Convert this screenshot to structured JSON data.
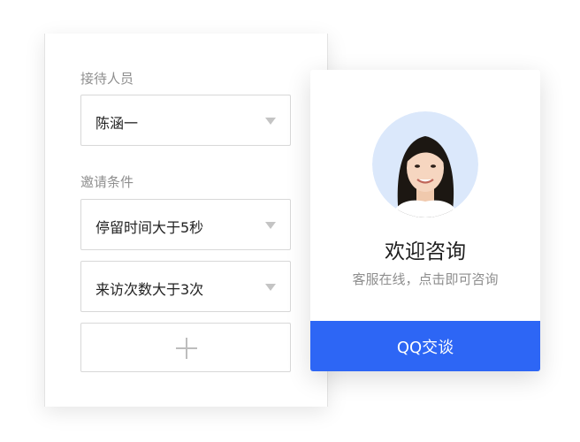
{
  "reception": {
    "label": "接待人员",
    "selected": "陈涵一"
  },
  "conditions": {
    "label": "邀请条件",
    "items": [
      {
        "value": "停留时间大于5秒"
      },
      {
        "value": "来访次数大于3次"
      }
    ]
  },
  "card": {
    "title": "欢迎咨询",
    "subtitle": "客服在线，点击即可咨询",
    "button_label": "QQ交谈"
  },
  "colors": {
    "accent": "#2d66f5",
    "avatar_bg": "#dbe8fb"
  },
  "icons": {
    "caret": "caret-down-icon",
    "add": "plus-icon"
  }
}
